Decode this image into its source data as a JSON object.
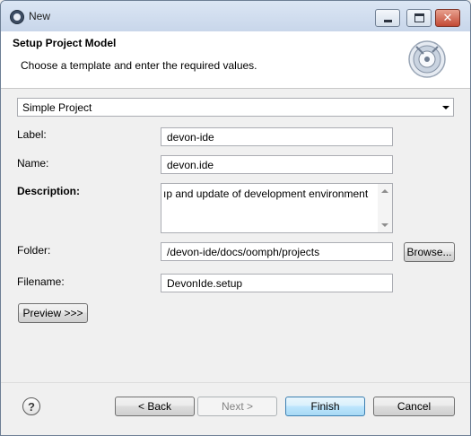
{
  "window": {
    "title": "New"
  },
  "banner": {
    "title": "Setup Project Model",
    "subtitle": "Choose a template and enter the required values.",
    "icon": "oomph-wizard-icon"
  },
  "template": {
    "selected": "Simple Project"
  },
  "form": {
    "label": {
      "label": "Label:",
      "value": "devon-ide"
    },
    "name": {
      "label": "Name:",
      "value": "devon.ide"
    },
    "description": {
      "label": "Description:",
      "value": "ıp and update of development environment"
    },
    "folder": {
      "label": "Folder:",
      "value": "/devon-ide/docs/oomph/projects",
      "browse": "Browse..."
    },
    "filename": {
      "label": "Filename:",
      "value": "DevonIde.setup"
    }
  },
  "preview": {
    "label": "Preview >>>"
  },
  "footer": {
    "back": "< Back",
    "next": "Next >",
    "finish": "Finish",
    "cancel": "Cancel",
    "help_glyph": "?"
  }
}
